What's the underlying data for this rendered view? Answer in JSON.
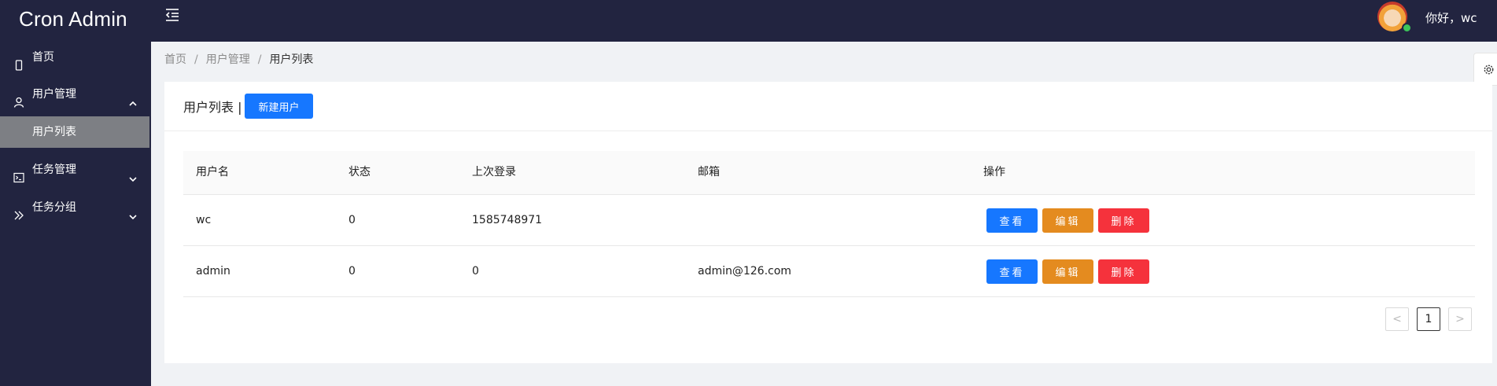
{
  "header": {
    "brand": "Cron Admin",
    "greeting": "你好，wc"
  },
  "sidebar": {
    "items": [
      {
        "label": "首页",
        "icon": "mobile-icon"
      },
      {
        "label": "用户管理",
        "icon": "user-icon",
        "expanded": true,
        "children": [
          {
            "label": "用户列表",
            "active": true
          }
        ]
      },
      {
        "label": "任务管理",
        "icon": "terminal-icon",
        "expanded": false
      },
      {
        "label": "任务分组",
        "icon": "double-right-icon",
        "expanded": false
      }
    ]
  },
  "breadcrumb": [
    "首页",
    "用户管理",
    "用户列表"
  ],
  "card": {
    "title": "用户列表 |",
    "new_button": "新建用户"
  },
  "table": {
    "columns": [
      "用户名",
      "状态",
      "上次登录",
      "邮箱",
      "操作"
    ],
    "rows": [
      {
        "username": "wc",
        "status": "0",
        "last_login": "1585748971",
        "email": ""
      },
      {
        "username": "admin",
        "status": "0",
        "last_login": "0",
        "email": "admin@126.com"
      }
    ],
    "actions": {
      "view": "查看",
      "edit": "编辑",
      "delete": "删除"
    }
  },
  "pagination": {
    "current": "1",
    "prev": "<",
    "next": ">"
  },
  "colors": {
    "topbar": "#222440",
    "primary": "#1677ff",
    "edit": "#e48b1f",
    "danger": "#f5323c",
    "active_menu": "#7d7f84"
  }
}
